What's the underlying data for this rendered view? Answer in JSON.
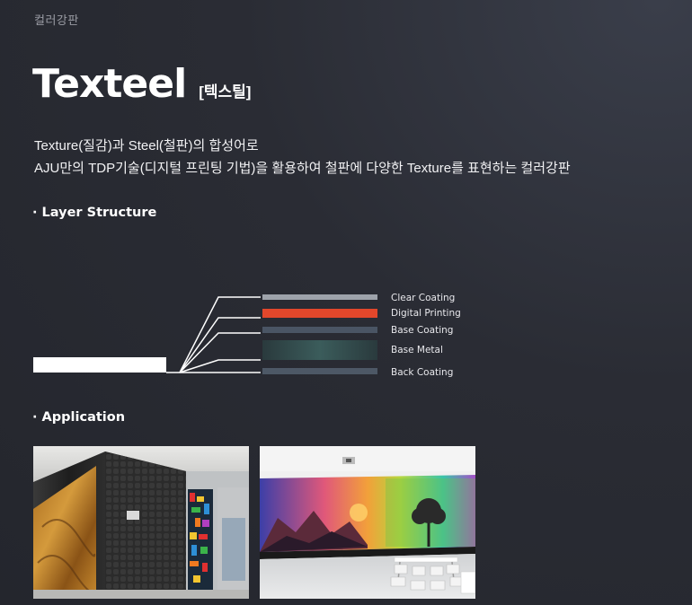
{
  "header": {
    "category": "컬러강판",
    "title": "Texteel",
    "title_korean": "[텍스틸]"
  },
  "description": {
    "line1": "Texture(질감)과 Steel(철판)의 합성어로",
    "line2": "AJU만의 TDP기술(디지털 프린팅 기법)을 활용하여 철판에 다양한 Texture를 표현하는 컬러강판"
  },
  "layer_structure": {
    "heading": "· Layer Structure",
    "layers": [
      {
        "label": "Clear Coating",
        "color": "#9ea3ab"
      },
      {
        "label": "Digital Printing",
        "color": "#e2472b"
      },
      {
        "label": "Base Coating",
        "color": "#4a5564"
      },
      {
        "label": "Base Metal",
        "color": "#2f4a4c"
      },
      {
        "label": "Back Coating",
        "color": "#4d5866"
      }
    ]
  },
  "application": {
    "heading": "· Application",
    "images": [
      {
        "icon": "interior-wall-photo"
      },
      {
        "icon": "cafeteria-mural-photo"
      }
    ]
  }
}
